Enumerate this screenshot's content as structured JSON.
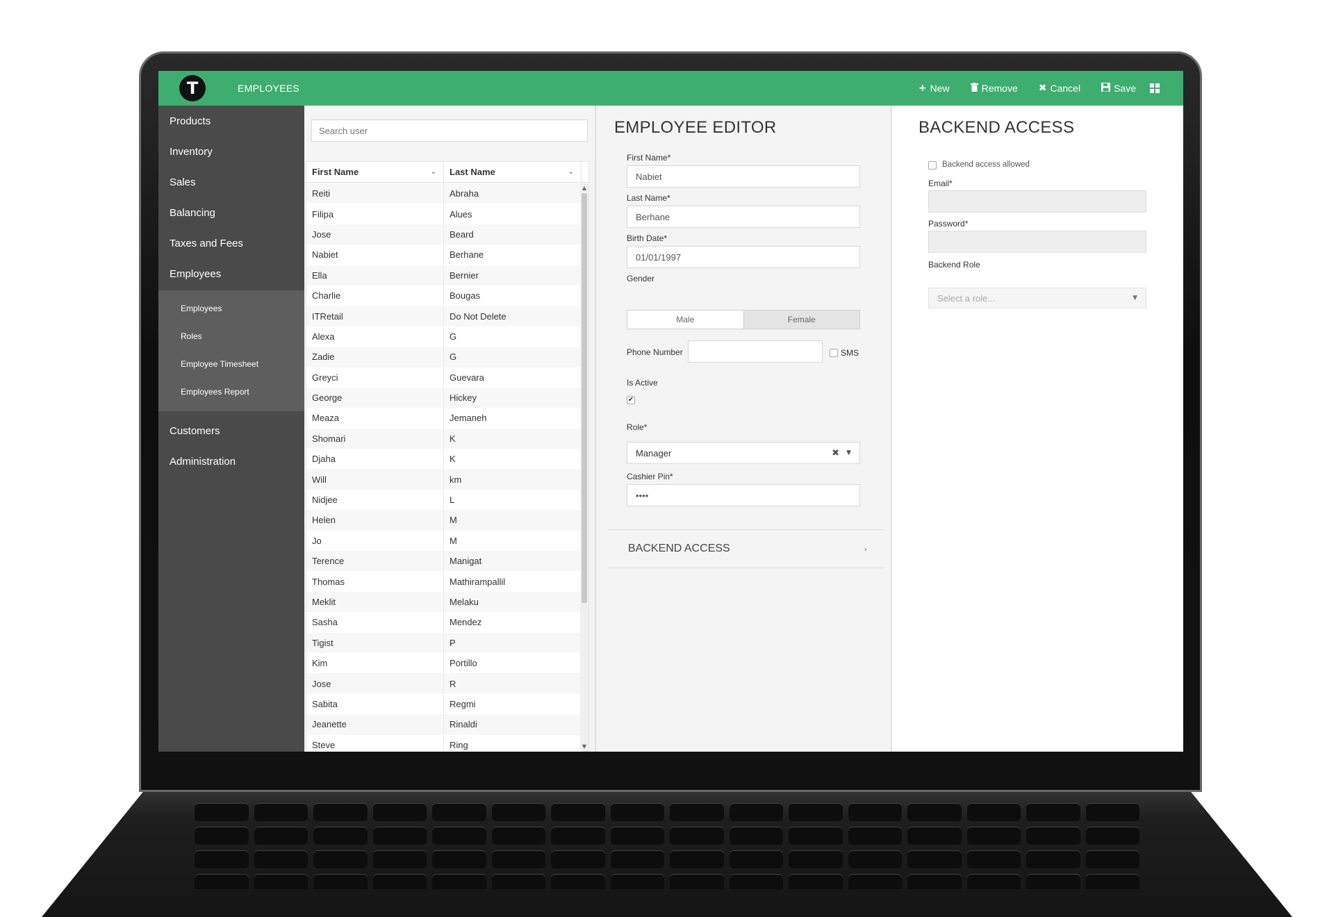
{
  "header": {
    "logo_letter": "T",
    "title": "EMPLOYEES"
  },
  "toolbar": {
    "new_label": "New",
    "new_icon": "plus-icon",
    "remove_label": "Remove",
    "remove_icon": "trash-icon",
    "cancel_label": "Cancel",
    "cancel_icon": "close-icon",
    "save_label": "Save",
    "save_icon": "floppy-icon",
    "grid_icon": "grid-icon"
  },
  "sidebar": {
    "items_top": [
      "Products",
      "Inventory",
      "Sales",
      "Balancing",
      "Taxes and Fees",
      "Employees"
    ],
    "sub_items": [
      "Employees",
      "Roles",
      "Employee Timesheet",
      "Employees Report"
    ],
    "items_bottom": [
      "Customers",
      "Administration"
    ]
  },
  "list": {
    "search_placeholder": "Search user",
    "columns": [
      "First Name",
      "Last Name"
    ],
    "rows": [
      [
        "Reiti",
        "Abraha"
      ],
      [
        "Filipa",
        "Alues"
      ],
      [
        "Jose",
        "Beard"
      ],
      [
        "Nabiet",
        "Berhane"
      ],
      [
        "Ella",
        "Bernier"
      ],
      [
        "Charlie",
        "Bougas"
      ],
      [
        "ITRetail",
        "Do Not Delete"
      ],
      [
        "Alexa",
        "G"
      ],
      [
        "Zadie",
        "G"
      ],
      [
        "Greyci",
        "Guevara"
      ],
      [
        "George",
        "Hickey"
      ],
      [
        "Meaza",
        "Jemaneh"
      ],
      [
        "Shomari",
        "K"
      ],
      [
        "Djaha",
        "K"
      ],
      [
        "Will",
        "km"
      ],
      [
        "Nidjee",
        "L"
      ],
      [
        "Helen",
        "M"
      ],
      [
        "Jo",
        "M"
      ],
      [
        "Terence",
        "Manigat"
      ],
      [
        "Thomas",
        "Mathirampallil"
      ],
      [
        "Meklit",
        "Melaku"
      ],
      [
        "Sasha",
        "Mendez"
      ],
      [
        "Tigist",
        "P"
      ],
      [
        "Kim",
        "Portillo"
      ],
      [
        "Jose",
        "R"
      ],
      [
        "Sabita",
        "Regmi"
      ],
      [
        "Jeanette",
        "Rinaldi"
      ],
      [
        "Steve",
        "Ring"
      ]
    ]
  },
  "editor": {
    "title": "EMPLOYEE EDITOR",
    "first_name_label": "First Name*",
    "first_name_value": "Nabiet",
    "last_name_label": "Last Name*",
    "last_name_value": "Berhane",
    "birth_date_label": "Birth Date*",
    "birth_date_value": "01/01/1997",
    "gender_label": "Gender",
    "gender_male": "Male",
    "gender_female": "Female",
    "gender_selected": "Female",
    "phone_label": "Phone Number",
    "phone_value": "",
    "sms_label": "SMS",
    "is_active_label": "Is Active",
    "is_active_checked": true,
    "role_label": "Role*",
    "role_value": "Manager",
    "cashier_pin_label": "Cashier Pin*",
    "cashier_pin_value": "••••",
    "backend_section_label": "BACKEND ACCESS"
  },
  "backend": {
    "title": "BACKEND ACCESS",
    "allowed_label": "Backend access allowed",
    "allowed_checked": false,
    "email_label": "Email*",
    "email_value": "",
    "password_label": "Password*",
    "password_value": "",
    "role_label": "Backend Role",
    "role_placeholder": "Select a role..."
  },
  "colors": {
    "accent": "#3dae6f",
    "sidebar": "#4a4a4a",
    "subnav": "#5e5e5e"
  }
}
